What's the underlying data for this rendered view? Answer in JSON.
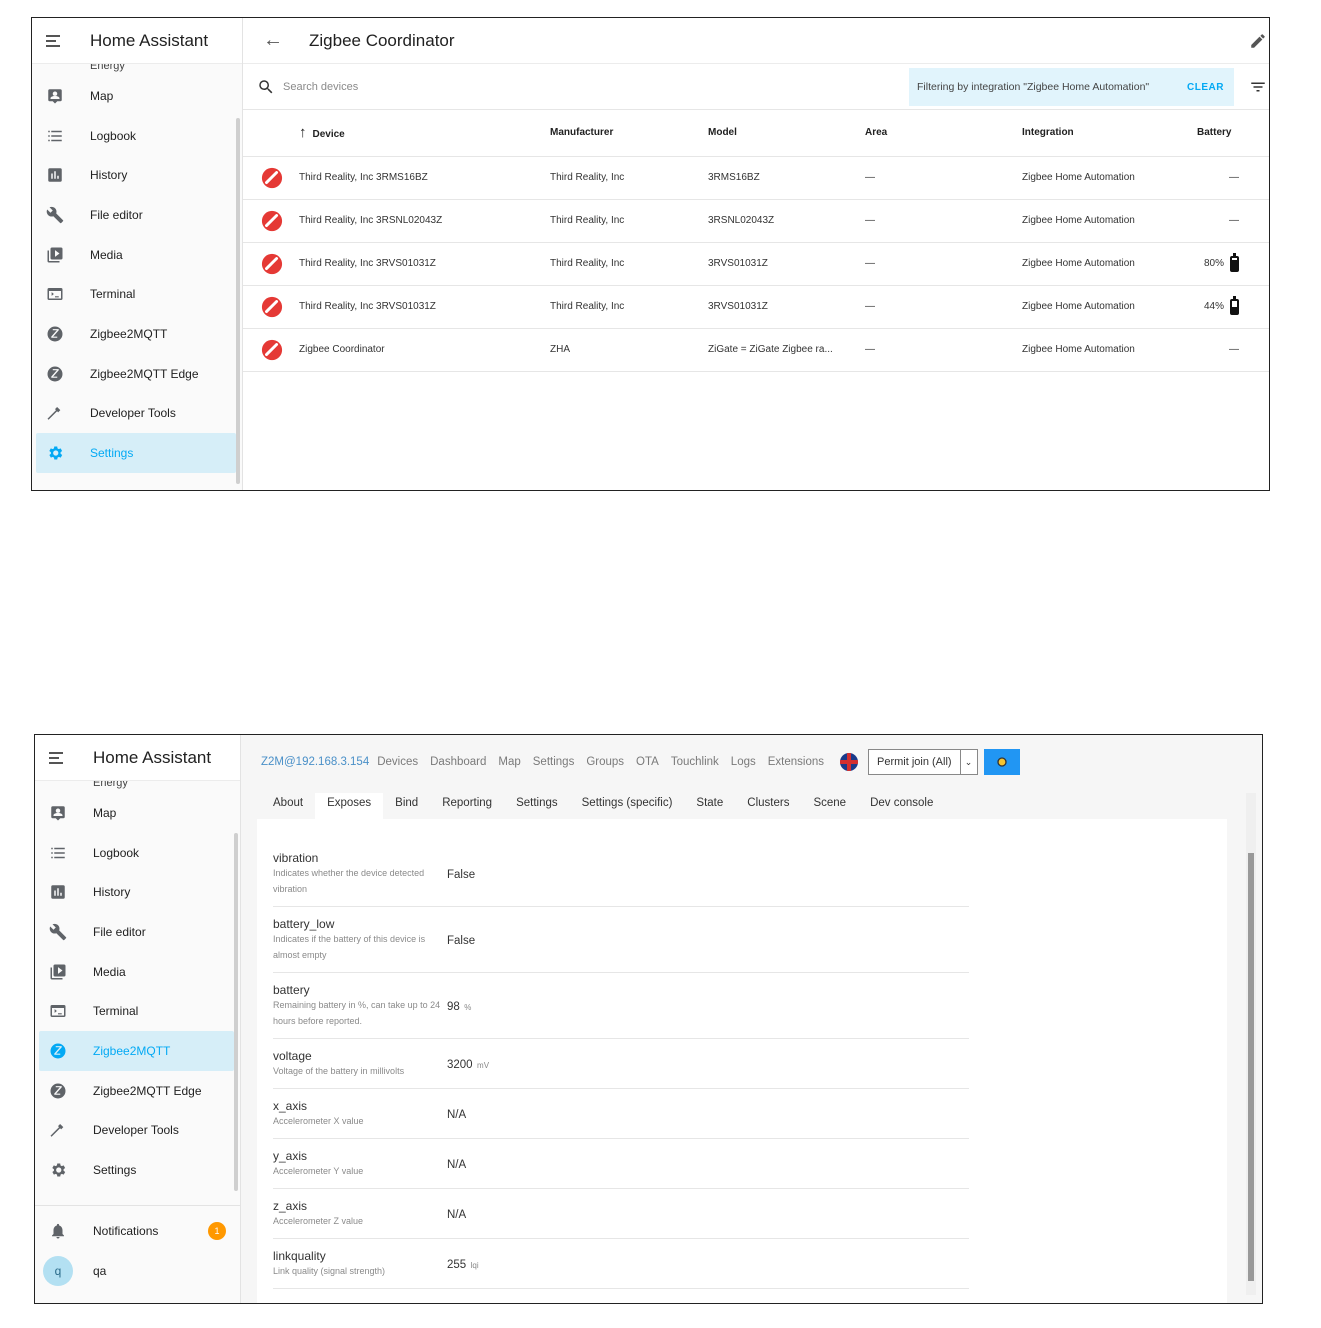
{
  "shot1": {
    "sidebar": {
      "title": "Home Assistant",
      "clipped_item": "Energy",
      "items": [
        {
          "label": "Map",
          "icon": "map-icon"
        },
        {
          "label": "Logbook",
          "icon": "logbook-icon"
        },
        {
          "label": "History",
          "icon": "history-icon"
        },
        {
          "label": "File editor",
          "icon": "wrench-icon"
        },
        {
          "label": "Media",
          "icon": "media-icon"
        },
        {
          "label": "Terminal",
          "icon": "terminal-icon"
        },
        {
          "label": "Zigbee2MQTT",
          "icon": "zigbee-icon"
        },
        {
          "label": "Zigbee2MQTT Edge",
          "icon": "zigbee-icon"
        },
        {
          "label": "Developer Tools",
          "icon": "hammer-icon"
        },
        {
          "label": "Settings",
          "icon": "gear-icon",
          "active": true
        }
      ]
    },
    "page_title": "Zigbee Coordinator",
    "search_placeholder": "Search devices",
    "filter_chip": "Filtering by integration \"Zigbee Home Automation\"",
    "clear_label": "CLEAR",
    "columns": [
      "Device",
      "Manufacturer",
      "Model",
      "Area",
      "Integration",
      "Battery"
    ],
    "rows": [
      {
        "device": "Third Reality, Inc 3RMS16BZ",
        "manufacturer": "Third Reality, Inc",
        "model": "3RMS16BZ",
        "area": "—",
        "integration": "Zigbee Home Automation",
        "battery": "—"
      },
      {
        "device": "Third Reality, Inc 3RSNL02043Z",
        "manufacturer": "Third Reality, Inc",
        "model": "3RSNL02043Z",
        "area": "—",
        "integration": "Zigbee Home Automation",
        "battery": "—"
      },
      {
        "device": "Third Reality, Inc 3RVS01031Z",
        "manufacturer": "Third Reality, Inc",
        "model": "3RVS01031Z",
        "area": "—",
        "integration": "Zigbee Home Automation",
        "battery": "80%",
        "battery_level": 0.8
      },
      {
        "device": "Third Reality, Inc 3RVS01031Z",
        "manufacturer": "Third Reality, Inc",
        "model": "3RVS01031Z",
        "area": "—",
        "integration": "Zigbee Home Automation",
        "battery": "44%",
        "battery_level": 0.44
      },
      {
        "device": "Zigbee Coordinator",
        "manufacturer": "ZHA",
        "model": "ZiGate = ZiGate Zigbee ra...",
        "area": "—",
        "integration": "Zigbee Home Automation",
        "battery": "—"
      }
    ],
    "colors": {
      "accent": "#03a9f4",
      "zha_icon": "#e53935"
    }
  },
  "shot2": {
    "sidebar": {
      "title": "Home Assistant",
      "clipped_item": "Energy",
      "items": [
        {
          "label": "Map",
          "icon": "map-icon"
        },
        {
          "label": "Logbook",
          "icon": "logbook-icon"
        },
        {
          "label": "History",
          "icon": "history-icon"
        },
        {
          "label": "File editor",
          "icon": "wrench-icon"
        },
        {
          "label": "Media",
          "icon": "media-icon"
        },
        {
          "label": "Terminal",
          "icon": "terminal-icon"
        },
        {
          "label": "Zigbee2MQTT",
          "icon": "zigbee-icon",
          "active": true
        },
        {
          "label": "Zigbee2MQTT Edge",
          "icon": "zigbee-icon"
        },
        {
          "label": "Developer Tools",
          "icon": "hammer-icon"
        },
        {
          "label": "Settings",
          "icon": "gear-icon"
        }
      ],
      "notifications_label": "Notifications",
      "notifications_badge": "1",
      "user_initial": "q",
      "user_name": "qa"
    },
    "brand": "Z2M@192.168.3.154",
    "nav": [
      "Devices",
      "Dashboard",
      "Map",
      "Settings",
      "Groups",
      "OTA",
      "Touchlink",
      "Logs",
      "Extensions"
    ],
    "permit_join": "Permit join (All)",
    "tabs": [
      "About",
      "Exposes",
      "Bind",
      "Reporting",
      "Settings",
      "Settings (specific)",
      "State",
      "Clusters",
      "Scene",
      "Dev console"
    ],
    "active_tab": "Exposes",
    "exposes": [
      {
        "name": "vibration",
        "help": "Indicates whether the device detected vibration",
        "value": "False",
        "unit": ""
      },
      {
        "name": "battery_low",
        "help": "Indicates if the battery of this device is almost empty",
        "value": "False",
        "unit": ""
      },
      {
        "name": "battery",
        "help": "Remaining battery in %, can take up to 24 hours before reported.",
        "value": "98",
        "unit": "%"
      },
      {
        "name": "voltage",
        "help": "Voltage of the battery in millivolts",
        "value": "3200",
        "unit": "mV"
      },
      {
        "name": "x_axis",
        "help": "Accelerometer X value",
        "value": "N/A",
        "unit": ""
      },
      {
        "name": "y_axis",
        "help": "Accelerometer Y value",
        "value": "N/A",
        "unit": ""
      },
      {
        "name": "z_axis",
        "help": "Accelerometer Z value",
        "value": "N/A",
        "unit": ""
      },
      {
        "name": "linkquality",
        "help": "Link quality (signal strength)",
        "value": "255",
        "unit": "lqi"
      }
    ]
  }
}
